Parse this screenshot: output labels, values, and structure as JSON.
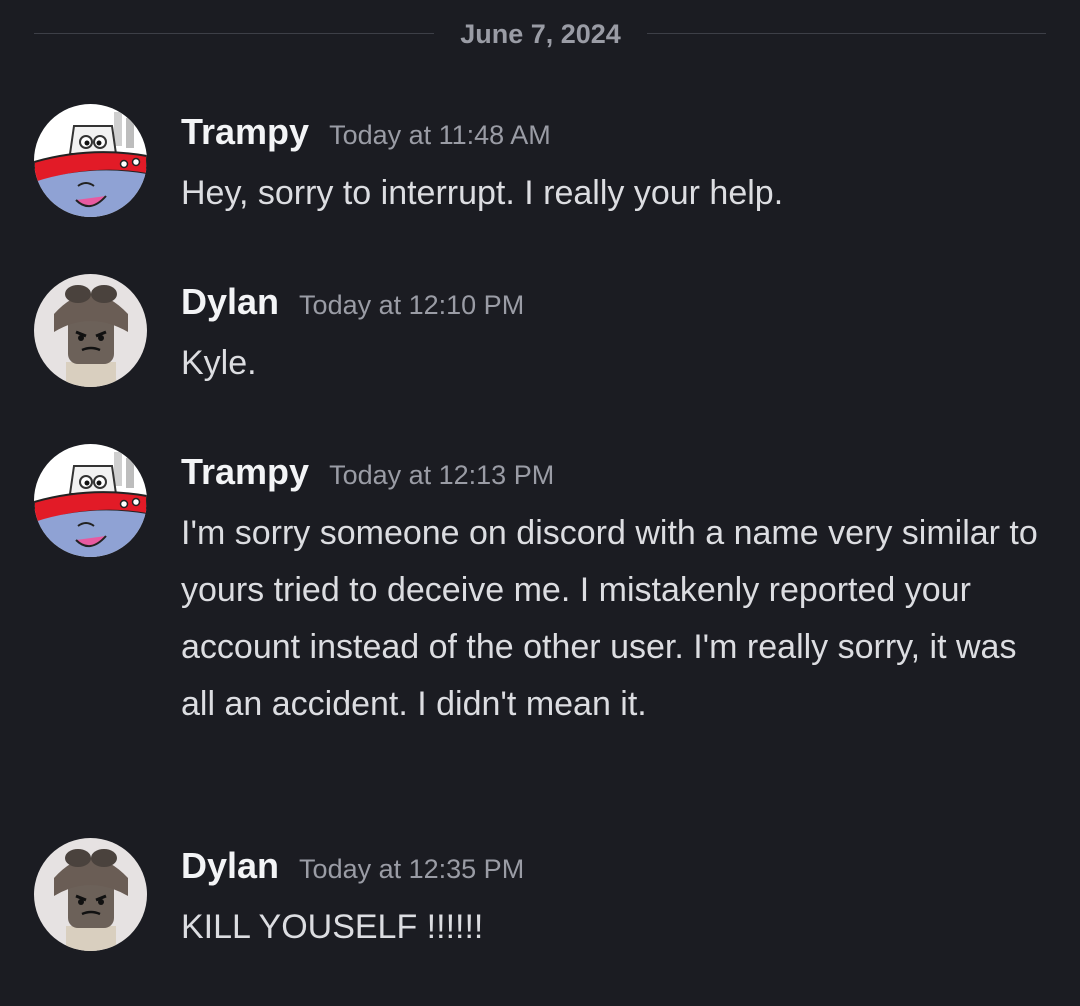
{
  "date_divider": "June 7, 2024",
  "messages": [
    {
      "username": "Trampy",
      "timestamp": "Today at 11:48 AM",
      "text": "Hey, sorry to interrupt. I really  your help.",
      "avatar_icon": "tugboat-cartoon-icon"
    },
    {
      "username": "Dylan",
      "timestamp": "Today at 12:10 PM",
      "text": "Kyle.",
      "avatar_icon": "minifigure-aviator-icon"
    },
    {
      "username": "Trampy",
      "timestamp": "Today at 12:13 PM",
      "text": "I'm sorry someone on discord with a name very similar to yours tried to deceive me. I mistakenly reported your account instead of the other user. I'm really sorry, it was all an accident. I didn't mean it.",
      "avatar_icon": "tugboat-cartoon-icon"
    },
    {
      "username": "Dylan",
      "timestamp": "Today at 12:35 PM",
      "text": "KILL YOUSELF !!!!!!",
      "avatar_icon": "minifigure-aviator-icon"
    }
  ],
  "colors": {
    "background": "#1b1c22",
    "username": "#f3f4f6",
    "timestamp": "#9a9ca5",
    "message_text": "#dcdde1",
    "divider": "#3d3f47"
  }
}
